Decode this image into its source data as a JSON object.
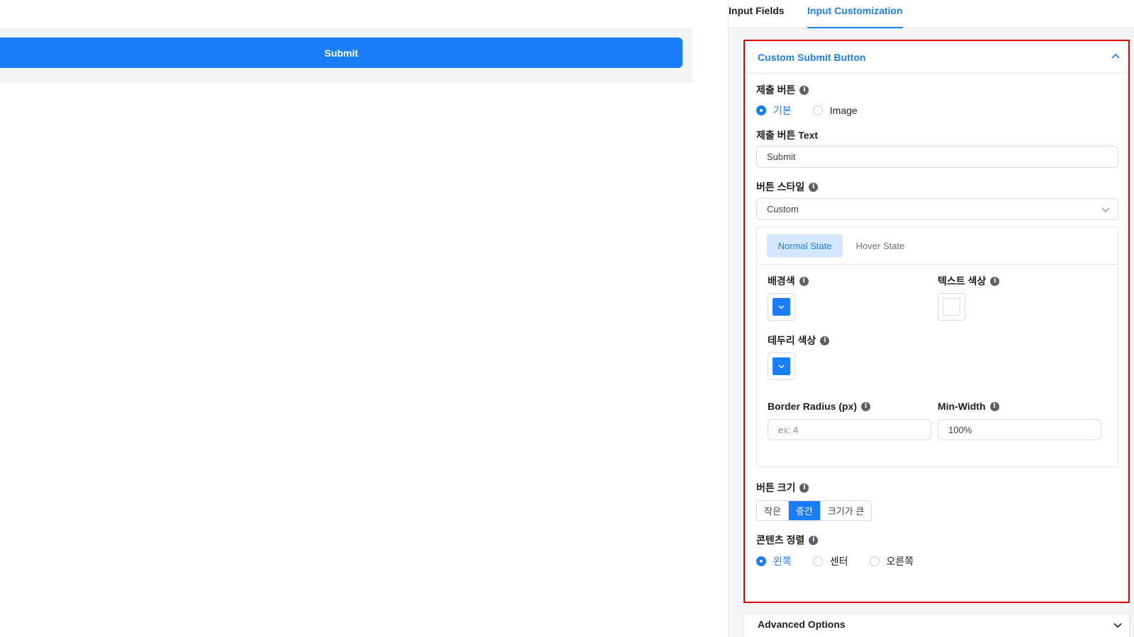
{
  "preview": {
    "submit_label": "Submit"
  },
  "tabs": [
    {
      "label": "Input Fields",
      "active": false
    },
    {
      "label": "Input Customization",
      "active": true
    }
  ],
  "panel": {
    "title": "Custom Submit Button",
    "submit_button": {
      "label": "제출 버튼",
      "options": [
        {
          "label": "기본",
          "selected": true
        },
        {
          "label": "Image",
          "selected": false
        }
      ]
    },
    "button_text": {
      "label": "제출 버튼 Text",
      "value": "Submit"
    },
    "button_style": {
      "label": "버튼 스타일",
      "selected": "Custom"
    },
    "states": {
      "normal": "Normal State",
      "hover": "Hover State"
    },
    "background_color": {
      "label": "배경색",
      "color": "#1a7efb"
    },
    "text_color": {
      "label": "텍스트 색상",
      "color": "#ffffff"
    },
    "border_color": {
      "label": "테두리 색상",
      "color": "#1a7efb"
    },
    "border_radius": {
      "label": "Border Radius (px)",
      "placeholder": "ex: 4"
    },
    "min_width": {
      "label": "Min-Width",
      "value": "100%"
    },
    "button_size": {
      "label": "버튼 크기",
      "options": [
        {
          "label": "작은",
          "selected": false
        },
        {
          "label": "중간",
          "selected": true
        },
        {
          "label": "크기가 큰",
          "selected": false
        }
      ]
    },
    "content_align": {
      "label": "콘텐츠 정렬",
      "options": [
        {
          "label": "왼쪽",
          "selected": true
        },
        {
          "label": "센터",
          "selected": false
        },
        {
          "label": "오른쪽",
          "selected": false
        }
      ]
    }
  },
  "advanced": {
    "title": "Advanced Options"
  },
  "colors": {
    "accent": "#1a7efb",
    "highlight_border": "#e00000"
  }
}
